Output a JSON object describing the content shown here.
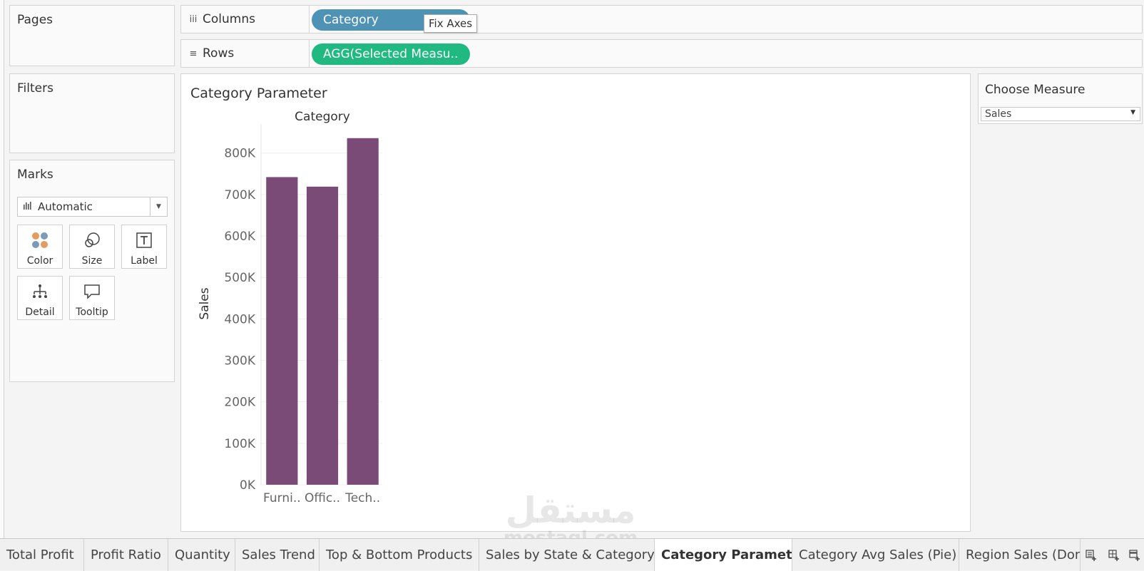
{
  "cards": {
    "pages_title": "Pages",
    "filters_title": "Filters",
    "marks_title": "Marks"
  },
  "shelves": {
    "columns_label": "Columns",
    "columns_pill": "Category",
    "rows_label": "Rows",
    "rows_pill": "AGG(Selected Measu..",
    "tooltip": "Fix Axes"
  },
  "marks": {
    "type": "Automatic",
    "buttons": {
      "color": "Color",
      "size": "Size",
      "label": "Label",
      "detail": "Detail",
      "tooltip": "Tooltip"
    }
  },
  "view": {
    "title": "Category Parameter"
  },
  "parameter": {
    "title": "Choose Measure",
    "value": "Sales"
  },
  "tabs": [
    {
      "label": "Total Profit",
      "active": false
    },
    {
      "label": "Profit Ratio",
      "active": false
    },
    {
      "label": "Quantity",
      "active": false
    },
    {
      "label": "Sales Trend",
      "active": false
    },
    {
      "label": "Top & Bottom Products",
      "active": false
    },
    {
      "label": "Sales by State & Category",
      "active": false
    },
    {
      "label": "Category Parameter",
      "active": true
    },
    {
      "label": "Category Avg Sales (Pie)",
      "active": false
    },
    {
      "label": "Region Sales (Donu",
      "active": false
    }
  ],
  "watermark": {
    "arabic": "مستقل",
    "latin": "mostaql.com"
  },
  "colors": {
    "bar": "#7b4b78",
    "columns_pill": "#4e92b5",
    "rows_pill": "#1fb981"
  },
  "chart_data": {
    "type": "bar",
    "header": "Category",
    "ylabel": "Sales",
    "categories": [
      "Furni..",
      "Offic..",
      "Tech.."
    ],
    "values": [
      742000,
      719000,
      836000
    ],
    "ylim": [
      0,
      870000
    ],
    "yticks": [
      0,
      100000,
      200000,
      300000,
      400000,
      500000,
      600000,
      700000,
      800000
    ],
    "ytick_labels": [
      "0K",
      "100K",
      "200K",
      "300K",
      "400K",
      "500K",
      "600K",
      "700K",
      "800K"
    ],
    "grid": true,
    "legend": "none"
  }
}
